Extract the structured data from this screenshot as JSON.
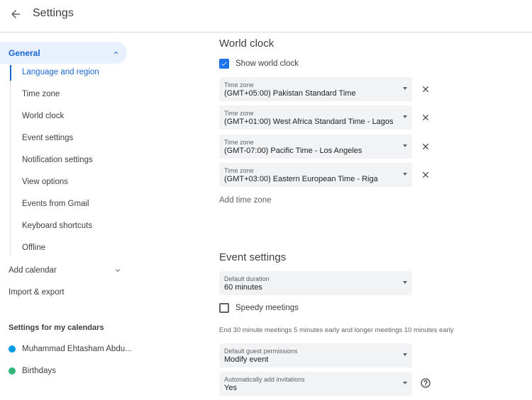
{
  "header": {
    "title": "Settings"
  },
  "sidebar": {
    "general": "General",
    "subitems": [
      "Language and region",
      "Time zone",
      "World clock",
      "Event settings",
      "Notification settings",
      "View options",
      "Events from Gmail",
      "Keyboard shortcuts",
      "Offline"
    ],
    "add_calendar": "Add calendar",
    "import_export": "Import & export",
    "my_calendars_label": "Settings for my calendars",
    "calendars": [
      {
        "name": "Muhammad Ehtasham Abdu...",
        "color": "#039be5"
      },
      {
        "name": "Birthdays",
        "color": "#33b679"
      }
    ]
  },
  "world_clock": {
    "title": "World clock",
    "show_label": "Show world clock",
    "show_checked": true,
    "zones": [
      {
        "label": "Time zone",
        "value": "(GMT+05:00) Pakistan Standard Time"
      },
      {
        "label": "Time zone",
        "value": "(GMT+01:00) West Africa Standard Time - Lagos"
      },
      {
        "label": "Time zone",
        "value": "(GMT-07:00) Pacific Time - Los Angeles"
      },
      {
        "label": "Time zone",
        "value": "(GMT+03:00) Eastern European Time - Riga"
      }
    ],
    "add_label": "Add time zone"
  },
  "event_settings": {
    "title": "Event settings",
    "default_duration": {
      "label": "Default duration",
      "value": "60 minutes"
    },
    "speedy_label": "Speedy meetings",
    "speedy_checked": false,
    "speedy_hint": "End 30 minute meetings 5 minutes early and longer meetings 10 minutes early",
    "guest_permissions": {
      "label": "Default guest permissions",
      "value": "Modify event"
    },
    "auto_invitations": {
      "label": "Automatically add invitations",
      "value": "Yes"
    }
  },
  "colors": {
    "accent": "#1a73e8",
    "active_bg": "#e8f0fe",
    "field_bg": "#f1f3f4"
  }
}
